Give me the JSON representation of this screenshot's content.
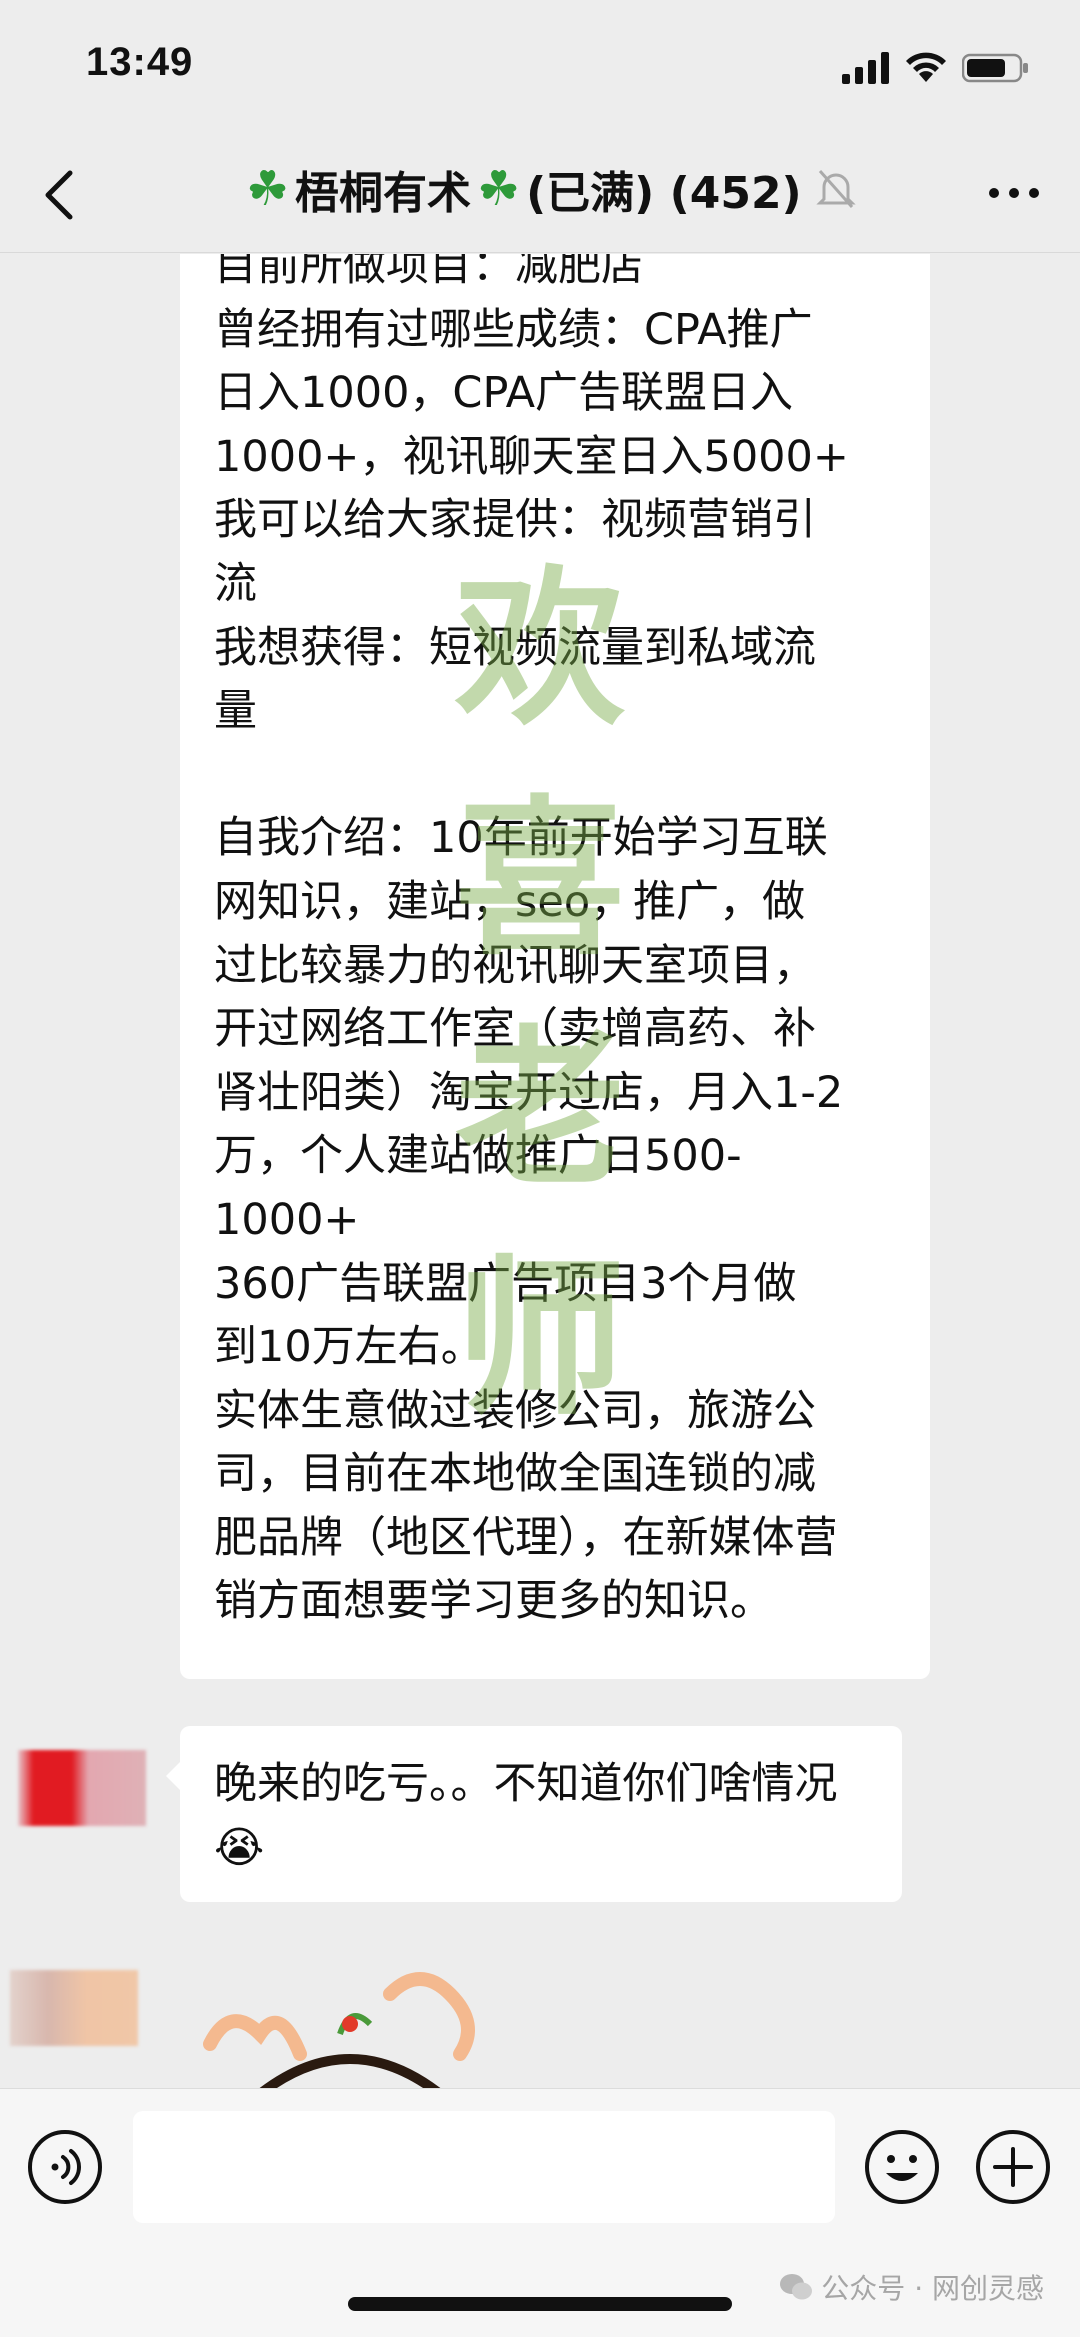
{
  "status_bar": {
    "time": "13:49"
  },
  "nav": {
    "title": "梧桐有术",
    "suffix": "(已满) (452)"
  },
  "messages": {
    "first_lines": [
      "目前所做项目：减肥店",
      "曾经拥有过哪些成绩：CPA推广",
      "日入1000，CPA广告联盟日入",
      "1000+，视讯聊天室日入5000+",
      "我可以给大家提供：视频营销引",
      "流",
      "我想获得：短视频流量到私域流",
      "量",
      "",
      "自我介绍：10年前开始学习互联",
      "网知识，建站，seo，推广，做",
      "过比较暴力的视讯聊天室项目，",
      "开过网络工作室（卖增高药、补",
      "肾壮阳类）淘宝开过店，月入1-2",
      "万，个人建站做推广日500-",
      "1000+",
      "360广告联盟广告项目3个月做",
      "到10万左右。",
      "实体生意做过装修公司，旅游公",
      "司，目前在本地做全国连锁的减",
      "肥品牌（地区代理），在新媒体营",
      "销方面想要学习更多的知识。"
    ],
    "second_lines": [
      "晚来的吃亏。。不知道你们啥情",
      "况😭"
    ],
    "watermark_chars": "欢喜老师"
  },
  "footer": {
    "watermark": "公众号 · 网创灵感"
  }
}
